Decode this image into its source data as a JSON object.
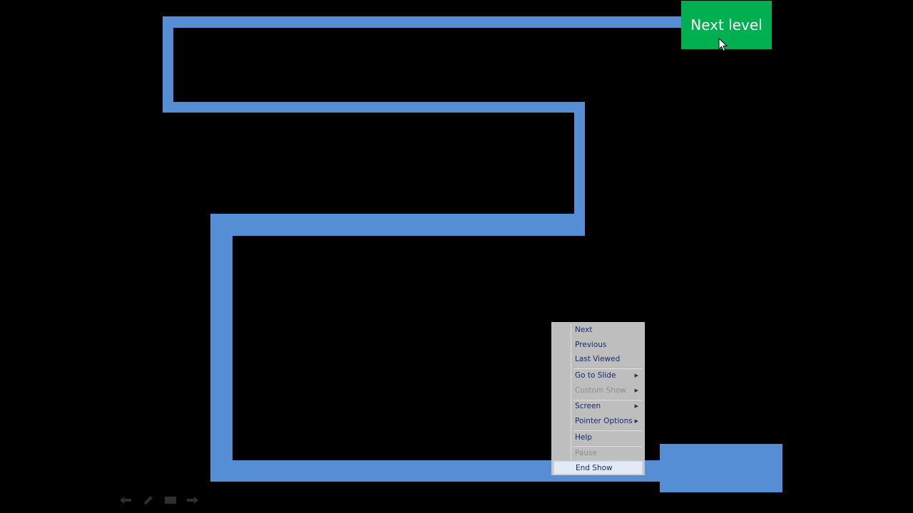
{
  "colors": {
    "background": "#000000",
    "maze": "#558ed5",
    "next_level": "#00b050",
    "menu_bg": "#cccccc",
    "menu_text": "#1a2a6c",
    "menu_disabled": "#8e8e8e"
  },
  "next_level_button": {
    "label": "Next level"
  },
  "context_menu": {
    "items": [
      {
        "label": "Next",
        "disabled": false,
        "submenu": false
      },
      {
        "label": "Previous",
        "disabled": false,
        "submenu": false
      },
      {
        "label": "Last Viewed",
        "disabled": false,
        "submenu": false
      },
      {
        "label": "Go to Slide",
        "disabled": false,
        "submenu": true
      },
      {
        "label": "Custom Show",
        "disabled": true,
        "submenu": true
      },
      {
        "label": "Screen",
        "disabled": false,
        "submenu": true
      },
      {
        "label": "Pointer Options",
        "disabled": false,
        "submenu": true
      },
      {
        "label": "Help",
        "disabled": false,
        "submenu": false
      },
      {
        "label": "Pause",
        "disabled": true,
        "submenu": false
      },
      {
        "label": "End Show",
        "disabled": false,
        "submenu": false,
        "highlighted": true
      }
    ]
  },
  "slideshow_controls": [
    {
      "icon": "previous-arrow-icon"
    },
    {
      "icon": "pen-icon"
    },
    {
      "icon": "slide-menu-icon"
    },
    {
      "icon": "next-arrow-icon"
    }
  ]
}
